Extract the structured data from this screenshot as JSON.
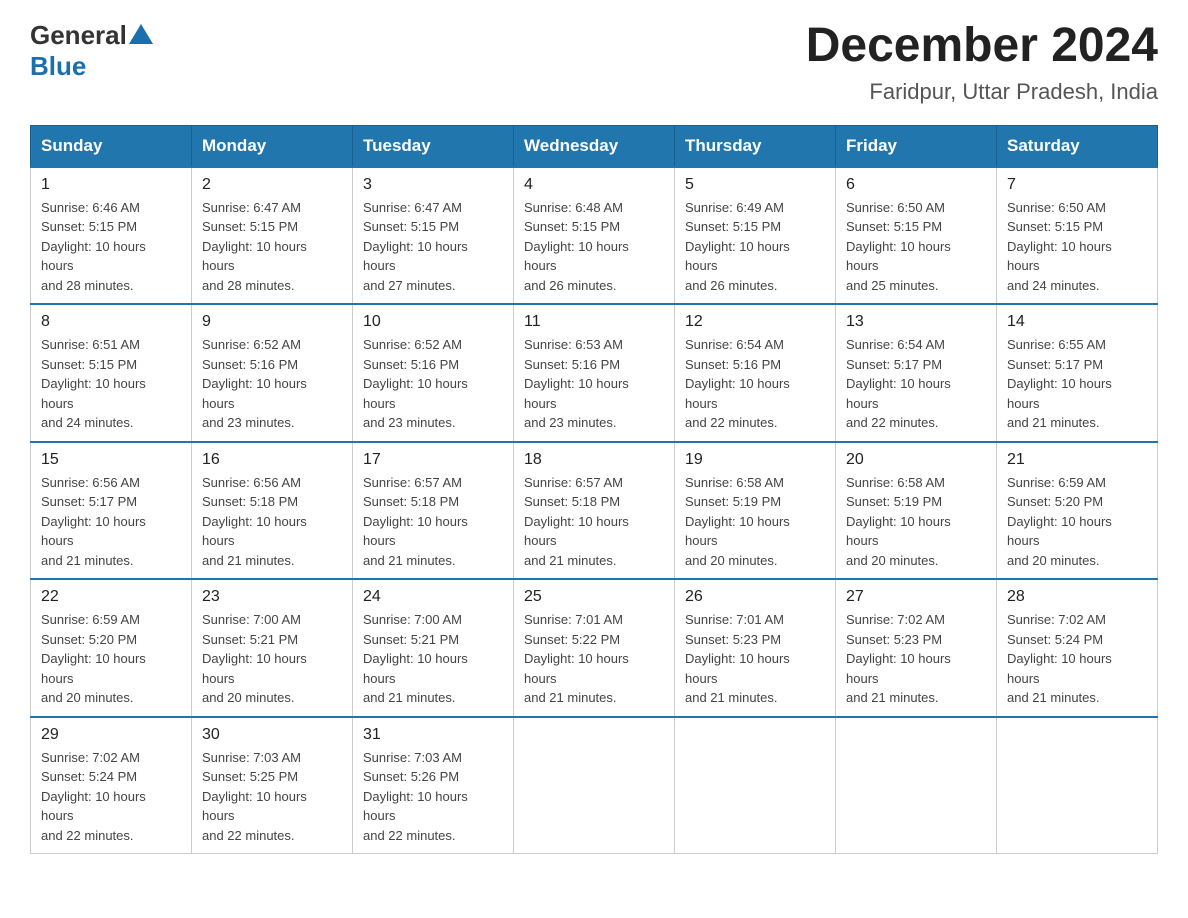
{
  "logo": {
    "general": "General",
    "blue": "Blue"
  },
  "title": "December 2024",
  "subtitle": "Faridpur, Uttar Pradesh, India",
  "days_of_week": [
    "Sunday",
    "Monday",
    "Tuesday",
    "Wednesday",
    "Thursday",
    "Friday",
    "Saturday"
  ],
  "weeks": [
    [
      {
        "day": "1",
        "sunrise": "6:46 AM",
        "sunset": "5:15 PM",
        "daylight": "10 hours and 28 minutes."
      },
      {
        "day": "2",
        "sunrise": "6:47 AM",
        "sunset": "5:15 PM",
        "daylight": "10 hours and 28 minutes."
      },
      {
        "day": "3",
        "sunrise": "6:47 AM",
        "sunset": "5:15 PM",
        "daylight": "10 hours and 27 minutes."
      },
      {
        "day": "4",
        "sunrise": "6:48 AM",
        "sunset": "5:15 PM",
        "daylight": "10 hours and 26 minutes."
      },
      {
        "day": "5",
        "sunrise": "6:49 AM",
        "sunset": "5:15 PM",
        "daylight": "10 hours and 26 minutes."
      },
      {
        "day": "6",
        "sunrise": "6:50 AM",
        "sunset": "5:15 PM",
        "daylight": "10 hours and 25 minutes."
      },
      {
        "day": "7",
        "sunrise": "6:50 AM",
        "sunset": "5:15 PM",
        "daylight": "10 hours and 24 minutes."
      }
    ],
    [
      {
        "day": "8",
        "sunrise": "6:51 AM",
        "sunset": "5:15 PM",
        "daylight": "10 hours and 24 minutes."
      },
      {
        "day": "9",
        "sunrise": "6:52 AM",
        "sunset": "5:16 PM",
        "daylight": "10 hours and 23 minutes."
      },
      {
        "day": "10",
        "sunrise": "6:52 AM",
        "sunset": "5:16 PM",
        "daylight": "10 hours and 23 minutes."
      },
      {
        "day": "11",
        "sunrise": "6:53 AM",
        "sunset": "5:16 PM",
        "daylight": "10 hours and 23 minutes."
      },
      {
        "day": "12",
        "sunrise": "6:54 AM",
        "sunset": "5:16 PM",
        "daylight": "10 hours and 22 minutes."
      },
      {
        "day": "13",
        "sunrise": "6:54 AM",
        "sunset": "5:17 PM",
        "daylight": "10 hours and 22 minutes."
      },
      {
        "day": "14",
        "sunrise": "6:55 AM",
        "sunset": "5:17 PM",
        "daylight": "10 hours and 21 minutes."
      }
    ],
    [
      {
        "day": "15",
        "sunrise": "6:56 AM",
        "sunset": "5:17 PM",
        "daylight": "10 hours and 21 minutes."
      },
      {
        "day": "16",
        "sunrise": "6:56 AM",
        "sunset": "5:18 PM",
        "daylight": "10 hours and 21 minutes."
      },
      {
        "day": "17",
        "sunrise": "6:57 AM",
        "sunset": "5:18 PM",
        "daylight": "10 hours and 21 minutes."
      },
      {
        "day": "18",
        "sunrise": "6:57 AM",
        "sunset": "5:18 PM",
        "daylight": "10 hours and 21 minutes."
      },
      {
        "day": "19",
        "sunrise": "6:58 AM",
        "sunset": "5:19 PM",
        "daylight": "10 hours and 20 minutes."
      },
      {
        "day": "20",
        "sunrise": "6:58 AM",
        "sunset": "5:19 PM",
        "daylight": "10 hours and 20 minutes."
      },
      {
        "day": "21",
        "sunrise": "6:59 AM",
        "sunset": "5:20 PM",
        "daylight": "10 hours and 20 minutes."
      }
    ],
    [
      {
        "day": "22",
        "sunrise": "6:59 AM",
        "sunset": "5:20 PM",
        "daylight": "10 hours and 20 minutes."
      },
      {
        "day": "23",
        "sunrise": "7:00 AM",
        "sunset": "5:21 PM",
        "daylight": "10 hours and 20 minutes."
      },
      {
        "day": "24",
        "sunrise": "7:00 AM",
        "sunset": "5:21 PM",
        "daylight": "10 hours and 21 minutes."
      },
      {
        "day": "25",
        "sunrise": "7:01 AM",
        "sunset": "5:22 PM",
        "daylight": "10 hours and 21 minutes."
      },
      {
        "day": "26",
        "sunrise": "7:01 AM",
        "sunset": "5:23 PM",
        "daylight": "10 hours and 21 minutes."
      },
      {
        "day": "27",
        "sunrise": "7:02 AM",
        "sunset": "5:23 PM",
        "daylight": "10 hours and 21 minutes."
      },
      {
        "day": "28",
        "sunrise": "7:02 AM",
        "sunset": "5:24 PM",
        "daylight": "10 hours and 21 minutes."
      }
    ],
    [
      {
        "day": "29",
        "sunrise": "7:02 AM",
        "sunset": "5:24 PM",
        "daylight": "10 hours and 22 minutes."
      },
      {
        "day": "30",
        "sunrise": "7:03 AM",
        "sunset": "5:25 PM",
        "daylight": "10 hours and 22 minutes."
      },
      {
        "day": "31",
        "sunrise": "7:03 AM",
        "sunset": "5:26 PM",
        "daylight": "10 hours and 22 minutes."
      },
      null,
      null,
      null,
      null
    ]
  ],
  "labels": {
    "sunrise": "Sunrise:",
    "sunset": "Sunset:",
    "daylight": "Daylight:"
  }
}
